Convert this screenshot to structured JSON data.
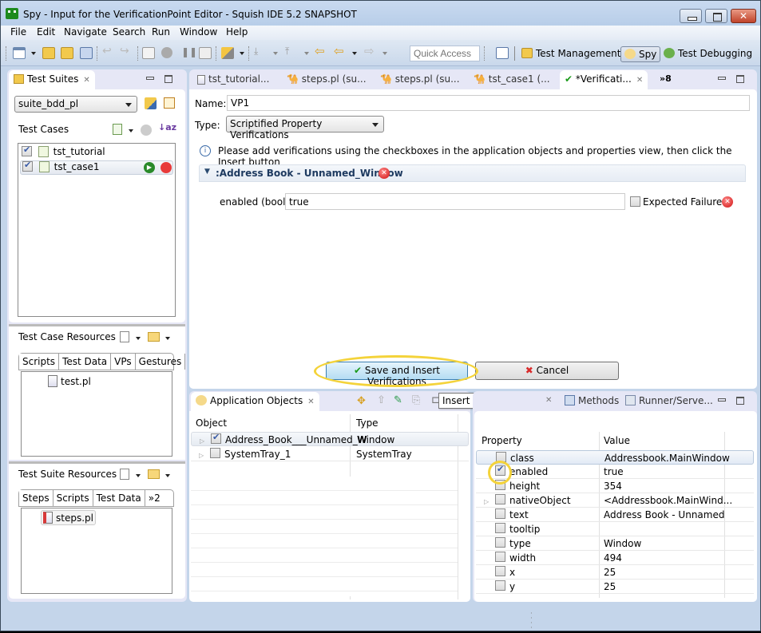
{
  "window": {
    "title": "Spy - Input for the VerificationPoint Editor - Squish IDE 5.2 SNAPSHOT",
    "close_glyph": "✕"
  },
  "menu": [
    "File",
    "Edit",
    "Navigate",
    "Search",
    "Run",
    "Window",
    "Help"
  ],
  "toolbar": {
    "quick_access_placeholder": "Quick Access",
    "perspectives": [
      {
        "label": "Test Management",
        "active": false
      },
      {
        "label": "Spy",
        "active": true
      },
      {
        "label": "Test Debugging",
        "active": false
      }
    ]
  },
  "test_suites": {
    "tab_label": "Test Suites",
    "suite_selected": "suite_bdd_pl",
    "test_cases_label": "Test Cases",
    "test_cases": [
      {
        "name": "tst_tutorial",
        "checked": true,
        "bdd": true,
        "selected": false
      },
      {
        "name": "tst_case1",
        "checked": true,
        "bdd": false,
        "selected": true
      }
    ]
  },
  "test_case_resources": {
    "label": "Test Case Resources",
    "tabs": [
      "Scripts",
      "Test Data",
      "VPs",
      "Gestures"
    ],
    "active_tab": "Scripts",
    "files": [
      "test.pl"
    ]
  },
  "test_suite_resources": {
    "label": "Test Suite Resources",
    "tabs": [
      "Steps",
      "Scripts",
      "Test Data"
    ],
    "overflow": "»2",
    "active_tab": "Steps",
    "files": [
      "steps.pl"
    ]
  },
  "editor": {
    "tabs": [
      {
        "label": "tst_tutorial...",
        "icon": "document-icon"
      },
      {
        "label": "steps.pl (su...",
        "icon": "camel-icon"
      },
      {
        "label": "steps.pl (su...",
        "icon": "camel-icon"
      },
      {
        "label": "tst_case1 (...",
        "icon": "camel-icon"
      },
      {
        "label": "*Verificati...",
        "icon": "checkmark-icon",
        "active": true
      }
    ],
    "overflow": "»8",
    "name_label": "Name:",
    "name_value": "VP1",
    "type_label": "Type:",
    "type_value": "Scriptified Property Verifications",
    "info_text": "Please add verifications using the checkboxes in the application objects and properties view, then click the Insert button",
    "section_title": ":Address Book - Unnamed_Window",
    "property_label": "enabled (bool)",
    "property_value": "true",
    "expected_failure_label": "Expected Failure",
    "expected_failure_checked": false,
    "save_button": "Save and Insert Verifications",
    "cancel_button": "Cancel"
  },
  "app_objects": {
    "tab_label": "Application Objects",
    "col_object": "Object",
    "col_type": "Type",
    "rows": [
      {
        "object": "Address_Book___Unnamed_W",
        "type": "Window",
        "checked": true
      },
      {
        "object": "SystemTray_1",
        "type": "SystemTray",
        "checked": false
      }
    ],
    "tooltip": "Insert Verification Point"
  },
  "properties": {
    "tabs": [
      "Methods",
      "Runner/Serve..."
    ],
    "col_property": "Property",
    "col_value": "Value",
    "rows": [
      {
        "name": "class",
        "value": "Addressbook.MainWindow",
        "checked": false,
        "expandable": false
      },
      {
        "name": "enabled",
        "value": "true",
        "checked": true,
        "expandable": false
      },
      {
        "name": "height",
        "value": "354",
        "checked": false,
        "expandable": false
      },
      {
        "name": "nativeObject",
        "value": "<Addressbook.MainWind...",
        "checked": false,
        "expandable": true
      },
      {
        "name": "text",
        "value": "Address Book - Unnamed",
        "checked": false,
        "expandable": false
      },
      {
        "name": "tooltip",
        "value": "",
        "checked": false,
        "expandable": false
      },
      {
        "name": "type",
        "value": "Window",
        "checked": false,
        "expandable": false
      },
      {
        "name": "width",
        "value": "494",
        "checked": false,
        "expandable": false
      },
      {
        "name": "x",
        "value": "25",
        "checked": false,
        "expandable": false
      },
      {
        "name": "y",
        "value": "25",
        "checked": false,
        "expandable": false
      }
    ]
  }
}
